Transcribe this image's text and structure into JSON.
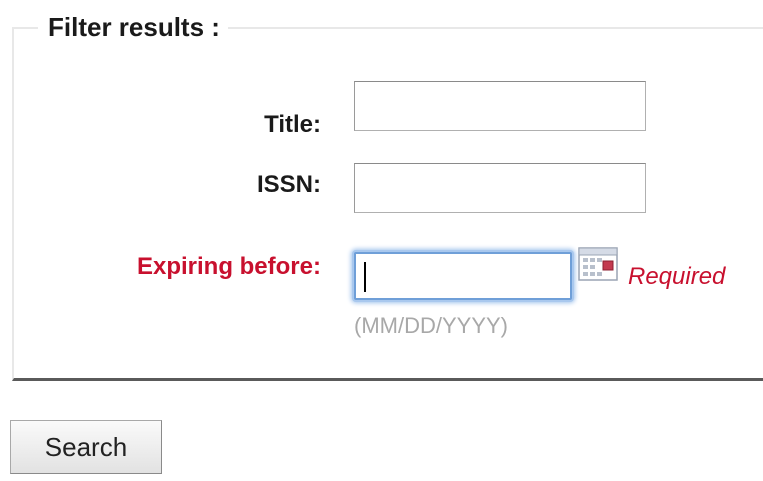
{
  "filter": {
    "legend": "Filter results :",
    "fields": {
      "title": {
        "label": "Title:",
        "value": "",
        "placeholder": ""
      },
      "issn": {
        "label": "ISSN:",
        "value": "",
        "placeholder": ""
      },
      "expiring": {
        "label": "Expiring before:",
        "value": "",
        "placeholder": "",
        "hint": "(MM/DD/YYYY)",
        "required_text": "Required",
        "icon": "calendar-icon"
      }
    }
  },
  "actions": {
    "search_label": "Search"
  },
  "colors": {
    "required_red": "#c8102e",
    "focus_blue": "#6f9fd8",
    "hint_gray": "#a8a8a8"
  }
}
